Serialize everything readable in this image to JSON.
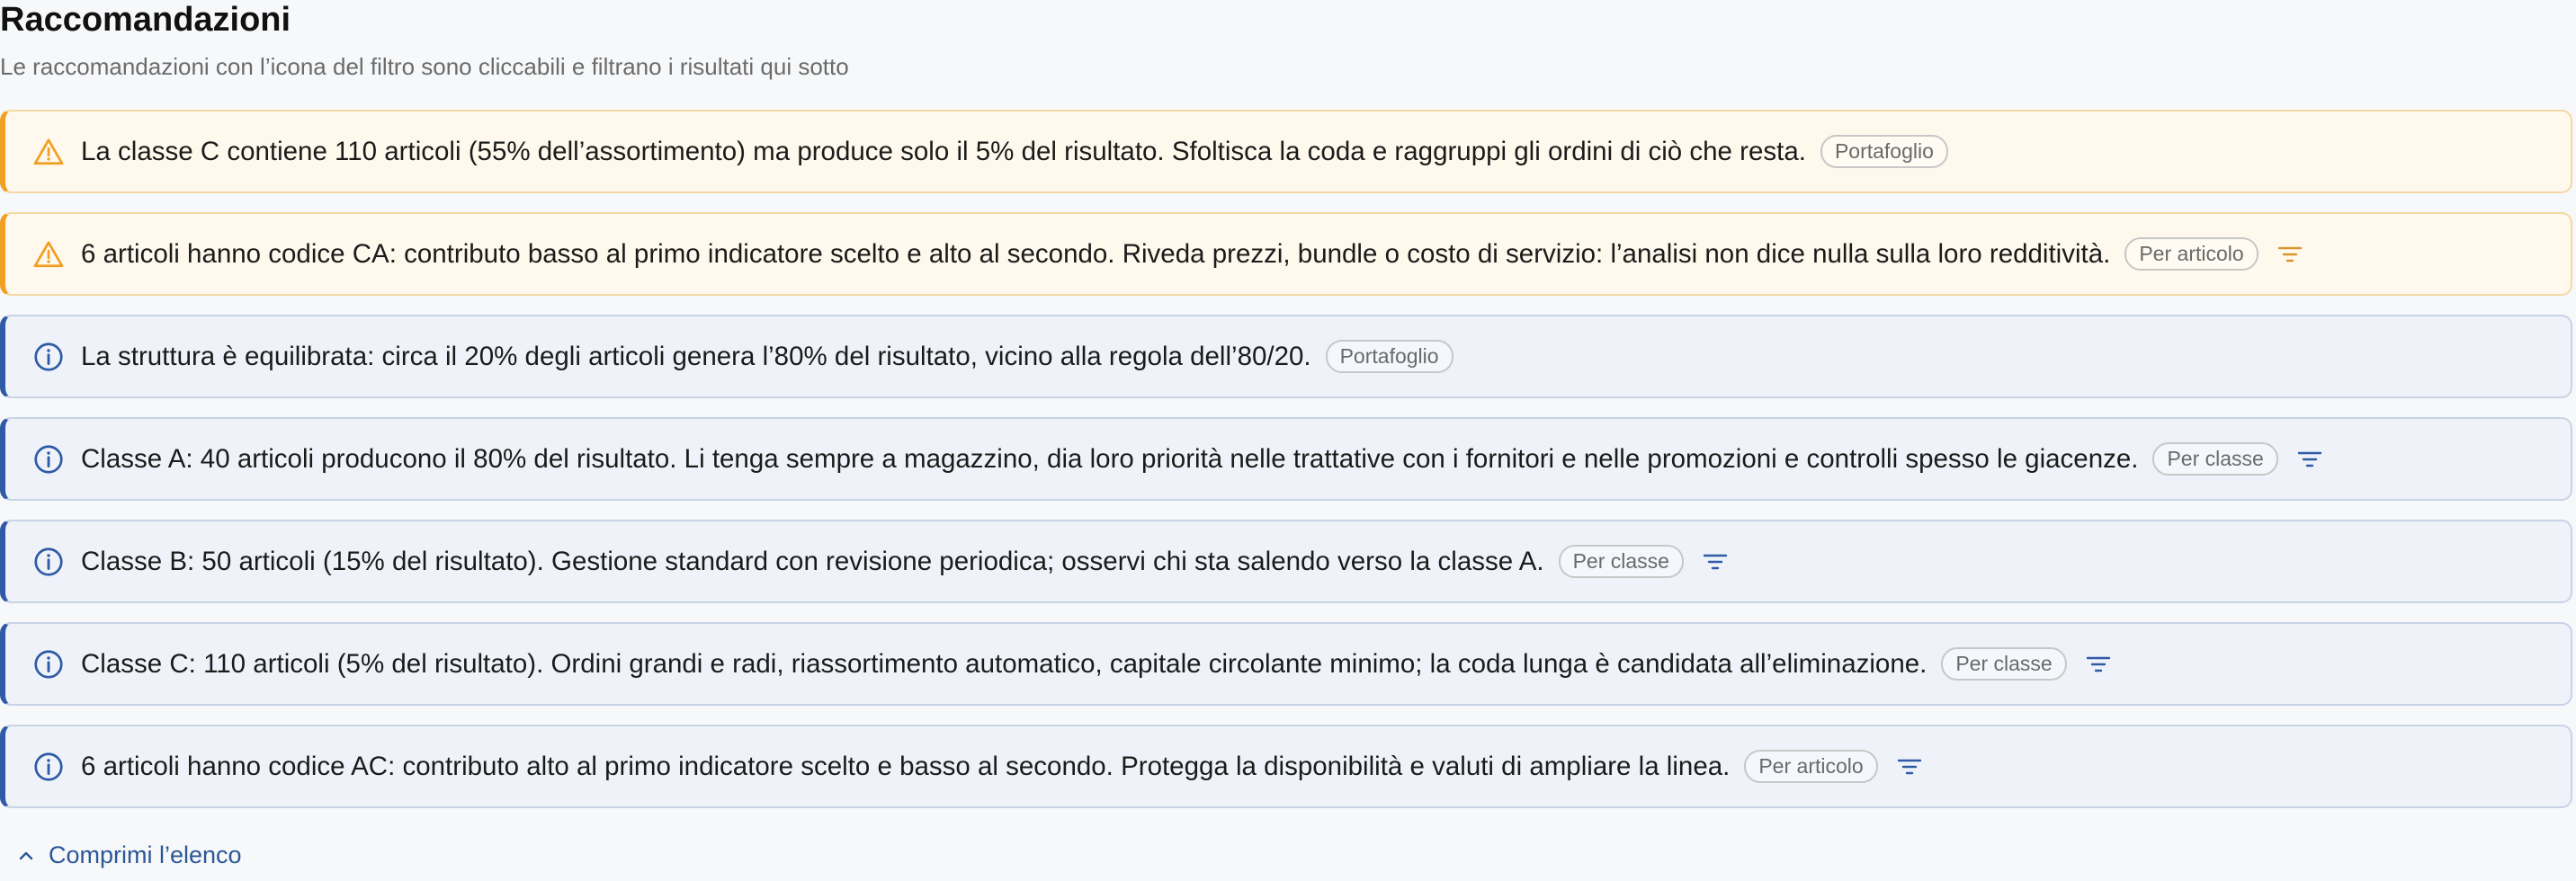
{
  "header": {
    "title": "Raccomandazioni",
    "subtitle": "Le raccomandazioni con l’icona del filtro sono cliccabili e filtrano i risultati qui sotto"
  },
  "colors": {
    "warning_accent": "#f0a020",
    "warning_bg": "#fff8ec",
    "info_accent": "#2e5aa6",
    "info_bg": "#eff3f9",
    "link": "#2b5797"
  },
  "recommendations": [
    {
      "kind": "warning",
      "icon": "warning-triangle-icon",
      "text": "La classe C contiene 110 articoli (55% dell’assortimento) ma produce solo il 5% del risultato. Sfoltisca la coda e raggruppi gli ordini di ciò che resta.",
      "badge": "Portafoglio",
      "filterable": false
    },
    {
      "kind": "warning",
      "icon": "warning-triangle-icon",
      "text": "6 articoli hanno codice CA: contributo basso al primo indicatore scelto e alto al secondo. Riveda prezzi, bundle o costo di servizio: l’analisi non dice nulla sulla loro redditività.",
      "badge": "Per articolo",
      "filterable": true
    },
    {
      "kind": "info",
      "icon": "info-circle-icon",
      "text": "La struttura è equilibrata: circa il 20% degli articoli genera l’80% del risultato, vicino alla regola dell’80/20.",
      "badge": "Portafoglio",
      "filterable": false
    },
    {
      "kind": "info",
      "icon": "info-circle-icon",
      "text": "Classe A: 40 articoli producono il 80% del risultato. Li tenga sempre a magazzino, dia loro priorità nelle trattative con i fornitori e nelle promozioni e controlli spesso le giacenze.",
      "badge": "Per classe",
      "filterable": true
    },
    {
      "kind": "info",
      "icon": "info-circle-icon",
      "text": "Classe B: 50 articoli (15% del risultato). Gestione standard con revisione periodica; osservi chi sta salendo verso la classe A.",
      "badge": "Per classe",
      "filterable": true
    },
    {
      "kind": "info",
      "icon": "info-circle-icon",
      "text": "Classe C: 110 articoli (5% del risultato). Ordini grandi e radi, riassortimento automatico, capitale circolante minimo; la coda lunga è candidata all’eliminazione.",
      "badge": "Per classe",
      "filterable": true
    },
    {
      "kind": "info",
      "icon": "info-circle-icon",
      "text": "6 articoli hanno codice AC: contributo alto al primo indicatore scelto e basso al secondo. Protegga la disponibilità e valuti di ampliare la linea.",
      "badge": "Per articolo",
      "filterable": true
    }
  ],
  "footer": {
    "collapse_label": "Comprimi l’elenco",
    "collapse_icon": "chevron-up-icon"
  }
}
